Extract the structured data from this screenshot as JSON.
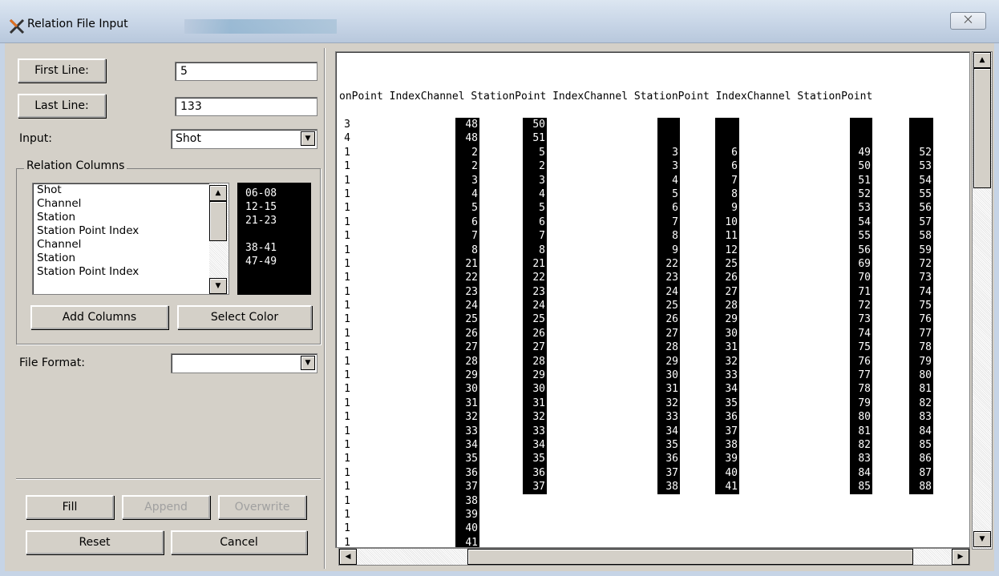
{
  "window": {
    "title": "Relation File Input",
    "close_label": "⨉"
  },
  "left": {
    "first_line_button": "First Line:",
    "first_line_value": "5",
    "last_line_button": "Last Line:",
    "last_line_value": "133",
    "input_label": "Input:",
    "input_value": "Shot",
    "relation_group_title": "Relation Columns",
    "relation_items": [
      "Shot",
      "Channel",
      "Station",
      "Station Point Index",
      "Channel",
      "Station",
      "Station Point Index"
    ],
    "relation_ranges": [
      "06-08",
      "12-15",
      "21-23",
      "",
      "38-41",
      "47-49",
      ""
    ],
    "add_columns": "Add Columns",
    "select_color": "Select Color",
    "file_format_label": "File Format:",
    "file_format_value": "",
    "fill": "Fill",
    "append": "Append",
    "overwrite": "Overwrite",
    "reset": "Reset",
    "cancel": "Cancel"
  },
  "preview": {
    "header": "onPoint IndexChannel StationPoint IndexChannel StationPoint IndexChannel StationPoint",
    "col_a": [
      "3",
      "4",
      "1",
      "1",
      "1",
      "1",
      "1",
      "1",
      "1",
      "1",
      "1",
      "1",
      "1",
      "1",
      "1",
      "1",
      "1",
      "1",
      "1",
      "1",
      "1",
      "1",
      "1",
      "1",
      "1",
      "1",
      "1",
      "1",
      "1",
      "1",
      "1"
    ],
    "col_b": [
      "48",
      "48",
      "2",
      "2",
      "3",
      "4",
      "5",
      "6",
      "7",
      "8",
      "21",
      "22",
      "23",
      "24",
      "25",
      "26",
      "27",
      "28",
      "29",
      "30",
      "31",
      "32",
      "33",
      "34",
      "35",
      "36",
      "37",
      "38",
      "39",
      "40",
      "41"
    ],
    "col_c": [
      "50",
      "51",
      "5",
      "2",
      "3",
      "4",
      "5",
      "6",
      "7",
      "8",
      "21",
      "22",
      "23",
      "24",
      "25",
      "26",
      "27",
      "28",
      "29",
      "30",
      "31",
      "32",
      "33",
      "34",
      "35",
      "36",
      "37"
    ],
    "col_d": [
      "",
      "",
      "3",
      "3",
      "4",
      "5",
      "6",
      "7",
      "8",
      "9",
      "22",
      "23",
      "24",
      "25",
      "26",
      "27",
      "28",
      "29",
      "30",
      "31",
      "32",
      "33",
      "34",
      "35",
      "36",
      "37",
      "38"
    ],
    "col_e": [
      "",
      "",
      "6",
      "6",
      "7",
      "8",
      "9",
      "10",
      "11",
      "12",
      "25",
      "26",
      "27",
      "28",
      "29",
      "30",
      "31",
      "32",
      "33",
      "34",
      "35",
      "36",
      "37",
      "38",
      "39",
      "40",
      "41"
    ],
    "col_f": [
      "",
      "",
      "49",
      "50",
      "51",
      "52",
      "53",
      "54",
      "55",
      "56",
      "69",
      "70",
      "71",
      "72",
      "73",
      "74",
      "75",
      "76",
      "77",
      "78",
      "79",
      "80",
      "81",
      "82",
      "83",
      "84",
      "85"
    ],
    "col_g": [
      "",
      "",
      "52",
      "53",
      "54",
      "55",
      "56",
      "57",
      "58",
      "59",
      "72",
      "73",
      "74",
      "75",
      "76",
      "77",
      "78",
      "79",
      "80",
      "81",
      "82",
      "83",
      "84",
      "85",
      "86",
      "87",
      "88"
    ]
  }
}
